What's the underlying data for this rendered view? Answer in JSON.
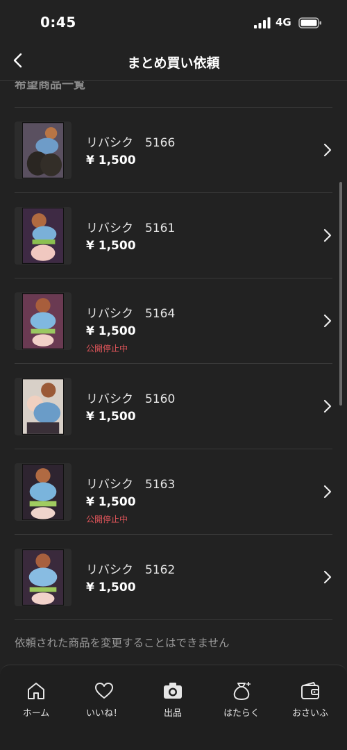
{
  "status_bar": {
    "time": "0:45",
    "network": "4G"
  },
  "nav": {
    "title": "まとめ買い依頼"
  },
  "section": {
    "title": "希望商品一覧"
  },
  "items": [
    {
      "name": "リバシク　5166",
      "price": "¥ 1,500",
      "status": ""
    },
    {
      "name": "リバシク　5161",
      "price": "¥ 1,500",
      "status": ""
    },
    {
      "name": "リバシク　5164",
      "price": "¥ 1,500",
      "status": "公開停止中"
    },
    {
      "name": "リバシク　5160",
      "price": "¥ 1,500",
      "status": ""
    },
    {
      "name": "リバシク　5163",
      "price": "¥ 1,500",
      "status": "公開停止中"
    },
    {
      "name": "リバシク　5162",
      "price": "¥ 1,500",
      "status": ""
    }
  ],
  "footer_note": "依頼された商品を変更することはできません",
  "tabs": [
    {
      "label": "ホーム",
      "icon": "home-icon"
    },
    {
      "label": "いいね！",
      "icon": "heart-icon"
    },
    {
      "label": "出品",
      "icon": "camera-icon"
    },
    {
      "label": "はたらく",
      "icon": "money-bag-icon"
    },
    {
      "label": "おさいふ",
      "icon": "wallet-icon"
    }
  ],
  "colors": {
    "background": "#222222",
    "status_warning": "#e0555a",
    "text_primary": "#ececec",
    "text_muted": "#9a9a9a"
  }
}
